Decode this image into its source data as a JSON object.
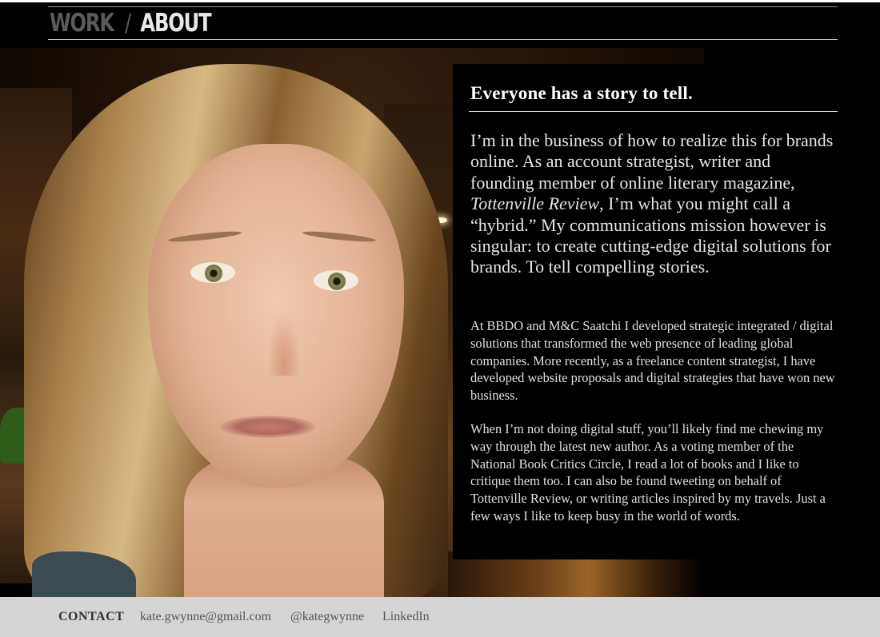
{
  "nav": {
    "work_label": "WORK",
    "separator": "/",
    "about_label": "ABOUT"
  },
  "about": {
    "heading": "Everyone has a story to tell.",
    "lead_before": "I’m in the business of how to realize this for brands online. As an account strategist, writer and founding member of online literary magazine, ",
    "lead_italic": "Tottenville Review",
    "lead_after": ", I’m what you might call a “hybrid.” My communications mission however is singular: to create cutting-edge digital solutions for brands. To tell compelling stories.",
    "paragraph_1": "At BBDO and M&C Saatchi I developed strategic integrated / digital solutions that transformed the web presence of leading global companies. More recently, as a freelance content strategist, I have developed website proposals and digital strategies that have won new business.",
    "paragraph_2": "When I’m not doing digital stuff, you’ll likely find me chewing my way through the latest new author. As a voting member of the National Book Critics Circle, I read a lot of books and I like to critique them too. I can also be found tweeting on behalf of Tottenville Review, or writing articles inspired by my travels. Just a few ways I like to keep busy in the world of words."
  },
  "footer": {
    "contact_label": "CONTACT",
    "email": "kate.gwynne@gmail.com",
    "twitter": "@kategwynne",
    "linkedin": "LinkedIn"
  },
  "colors": {
    "background": "#000000",
    "footer_bg": "#d5d5d5",
    "nav_inactive": "#5a5a5a",
    "nav_active": "#e8e8e8"
  }
}
